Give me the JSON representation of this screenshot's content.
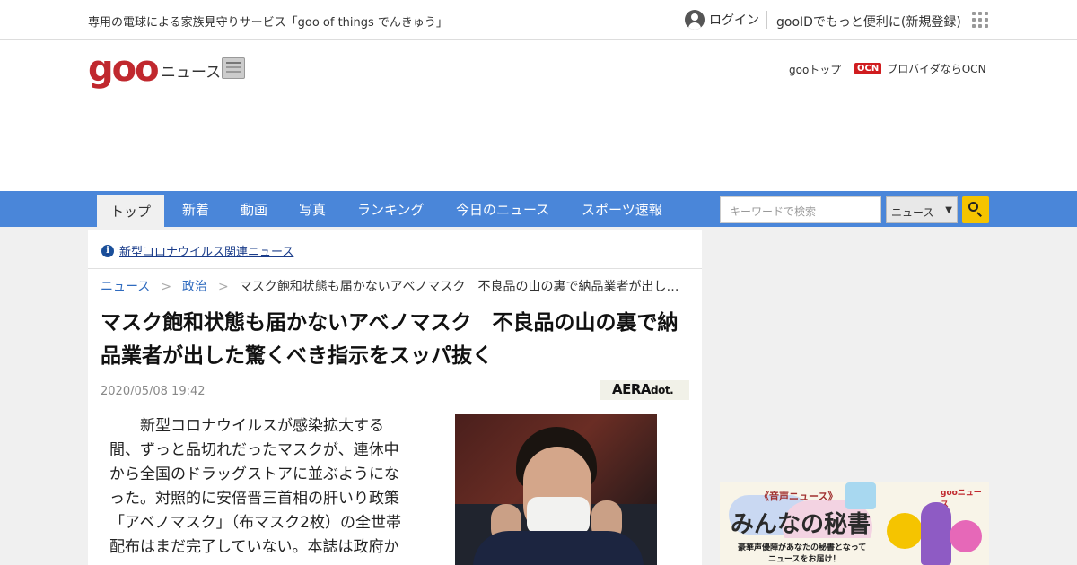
{
  "topbar": {
    "promo": "専用の電球による家族見守りサービス「goo of things でんきゅう」",
    "login": "ログイン",
    "signup": "gooIDでもっと便利に(新規登録)"
  },
  "header": {
    "logo": "goo",
    "section": "ニュース",
    "goo_top": "gooトップ",
    "ocn_badge": "OCN",
    "ocn_text": "プロバイダならOCN"
  },
  "nav": {
    "tabs": [
      "トップ",
      "新着",
      "動画",
      "写真",
      "ランキング",
      "今日のニュース",
      "スポーツ速報"
    ],
    "search_placeholder": "キーワードで検索",
    "search_scope": "ニュース"
  },
  "notice": {
    "text": "新型コロナウイルス関連ニュース"
  },
  "breadcrumb": {
    "items": [
      "ニュース",
      "政治",
      "マスク飽和状態も届かないアベノマスク　不良品の山の裏で納品業者が出し…"
    ],
    "separator": ">"
  },
  "article": {
    "title": "マスク飽和状態も届かないアベノマスク　不良品の山の裏で納品業者が出した驚くべき指示をスッパ抜く",
    "date": "2020/05/08 19:42",
    "source": "AERA",
    "source_suffix": "dot.",
    "body": "新型コロナウイルスが感染拡大する間、ずっと品切れだったマスクが、連休中から全国のドラッグストアに並ぶようになった。対照的に安倍晋三首相の肝いり政策「アベノマスク」（布マスク2枚）の全世帯配布はまだ完了していない。本誌は政府か"
  },
  "ad": {
    "tag": "《音声ニュース》",
    "headline": "みんなの秘書",
    "line1": "豪華声優陣があなたの秘書となって",
    "line2": "ニュースをお届け！",
    "brand": "gooニュース"
  },
  "colors": {
    "nav_bg": "#4a86d9",
    "logo_red": "#c0282e",
    "search_button": "#f5c400",
    "link_blue": "#2f6bbf"
  }
}
